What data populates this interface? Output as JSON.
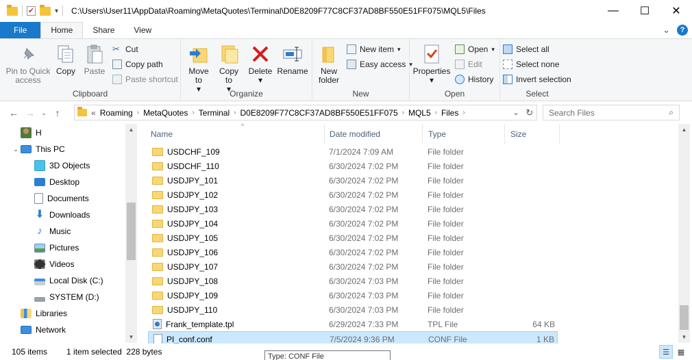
{
  "window": {
    "path": "C:\\Users\\User11\\AppData\\Roaming\\MetaQuotes\\Terminal\\D0E8209F77C8CF37AD8BF550E51FF075\\MQL5\\Files",
    "minimize": "—",
    "maximize": "☐",
    "close": "✕"
  },
  "tabs": {
    "file": "File",
    "home": "Home",
    "share": "Share",
    "view": "View",
    "expand": "⌄",
    "help": "?"
  },
  "ribbon": {
    "clipboard": {
      "label": "Clipboard",
      "pin": "Pin to Quick access",
      "copy": "Copy",
      "paste": "Paste",
      "cut": "Cut",
      "copy_path": "Copy path",
      "paste_shortcut": "Paste shortcut"
    },
    "organize": {
      "label": "Organize",
      "move_to": "Move to",
      "copy_to": "Copy to",
      "delete": "Delete",
      "rename": "Rename"
    },
    "new": {
      "label": "New",
      "new_folder": "New folder",
      "new_item": "New item",
      "easy_access": "Easy access"
    },
    "open": {
      "label": "Open",
      "properties": "Properties",
      "open": "Open",
      "edit": "Edit",
      "history": "History"
    },
    "select": {
      "label": "Select",
      "select_all": "Select all",
      "select_none": "Select none",
      "invert": "Invert selection"
    }
  },
  "address": {
    "overflow": "«",
    "segments": [
      "Roaming",
      "MetaQuotes",
      "Terminal",
      "D0E8209F77C8CF37AD8BF550E51FF075",
      "MQL5",
      "Files"
    ],
    "search_placeholder": "Search Files"
  },
  "nav": {
    "items": [
      {
        "label": "H",
        "icon": "user-icon"
      },
      {
        "label": "This PC",
        "icon": "computer-icon"
      },
      {
        "label": "3D Objects",
        "icon": "cube-icon"
      },
      {
        "label": "Desktop",
        "icon": "desktop-icon"
      },
      {
        "label": "Documents",
        "icon": "document-icon"
      },
      {
        "label": "Downloads",
        "icon": "download-icon"
      },
      {
        "label": "Music",
        "icon": "music-icon"
      },
      {
        "label": "Pictures",
        "icon": "picture-icon"
      },
      {
        "label": "Videos",
        "icon": "video-icon"
      },
      {
        "label": "Local Disk (C:)",
        "icon": "disk-icon"
      },
      {
        "label": "SYSTEM (D:)",
        "icon": "drive-icon"
      },
      {
        "label": "Libraries",
        "icon": "library-icon"
      },
      {
        "label": "Network",
        "icon": "network-icon"
      }
    ]
  },
  "columns": {
    "name": "Name",
    "date": "Date modified",
    "type": "Type",
    "size": "Size"
  },
  "files": [
    {
      "name": "USDCHF_109",
      "date": "7/1/2024 7:09 AM",
      "type": "File folder",
      "size": "",
      "kind": "folder"
    },
    {
      "name": "USDCHF_110",
      "date": "6/30/2024 7:02 PM",
      "type": "File folder",
      "size": "",
      "kind": "folder"
    },
    {
      "name": "USDJPY_101",
      "date": "6/30/2024 7:02 PM",
      "type": "File folder",
      "size": "",
      "kind": "folder"
    },
    {
      "name": "USDJPY_102",
      "date": "6/30/2024 7:02 PM",
      "type": "File folder",
      "size": "",
      "kind": "folder"
    },
    {
      "name": "USDJPY_103",
      "date": "6/30/2024 7:02 PM",
      "type": "File folder",
      "size": "",
      "kind": "folder"
    },
    {
      "name": "USDJPY_104",
      "date": "6/30/2024 7:02 PM",
      "type": "File folder",
      "size": "",
      "kind": "folder"
    },
    {
      "name": "USDJPY_105",
      "date": "6/30/2024 7:02 PM",
      "type": "File folder",
      "size": "",
      "kind": "folder"
    },
    {
      "name": "USDJPY_106",
      "date": "6/30/2024 7:02 PM",
      "type": "File folder",
      "size": "",
      "kind": "folder"
    },
    {
      "name": "USDJPY_107",
      "date": "6/30/2024 7:02 PM",
      "type": "File folder",
      "size": "",
      "kind": "folder"
    },
    {
      "name": "USDJPY_108",
      "date": "6/30/2024 7:03 PM",
      "type": "File folder",
      "size": "",
      "kind": "folder"
    },
    {
      "name": "USDJPY_109",
      "date": "6/30/2024 7:03 PM",
      "type": "File folder",
      "size": "",
      "kind": "folder"
    },
    {
      "name": "USDJPY_110",
      "date": "6/30/2024 7:03 PM",
      "type": "File folder",
      "size": "",
      "kind": "folder"
    },
    {
      "name": "Frank_template.tpl",
      "date": "6/29/2024 7:33 PM",
      "type": "TPL File",
      "size": "64 KB",
      "kind": "tpl"
    },
    {
      "name": "PI_conf.conf",
      "date": "7/5/2024 9:36 PM",
      "type": "CONF File",
      "size": "1 KB",
      "kind": "conf",
      "selected": true
    }
  ],
  "status": {
    "items": "105 items",
    "selected": "1 item selected  228 bytes"
  },
  "tooltip": "Type: CONF File",
  "colors": {
    "accent": "#1979ca",
    "selection": "#cce8ff",
    "selection_border": "#99d1ff",
    "folder": "#f8d775"
  }
}
